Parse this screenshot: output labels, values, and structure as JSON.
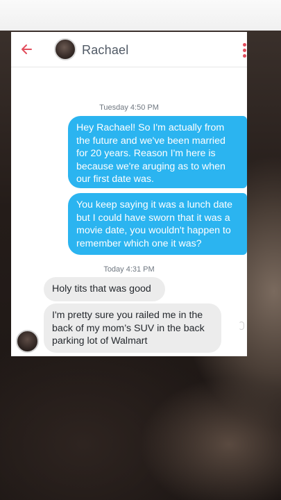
{
  "colors": {
    "accent": "#e24d5c",
    "outgoing_bubble": "#2bb4f0",
    "incoming_bubble": "#ececec"
  },
  "header": {
    "back_icon": "arrow-left-icon",
    "contact_name": "Rachael",
    "menu_icon": "more-vertical-icon"
  },
  "conversation": {
    "timestamp_1": "Tuesday 4:50 PM",
    "outgoing": [
      "Hey Rachael! So I'm actually from the future and we've been married for 20 years. Reason I'm here is because we're aruging as to when our first date was.",
      "You keep saying it was a lunch date but I could have sworn that it was a movie date, you wouldn't happen to remember which one it was?"
    ],
    "timestamp_2": "Today 4:31 PM",
    "incoming": [
      "Holy tits that was good",
      "I'm pretty sure you railed me in the back of my mom’s SUV in the back parking lot of Walmart"
    ]
  }
}
